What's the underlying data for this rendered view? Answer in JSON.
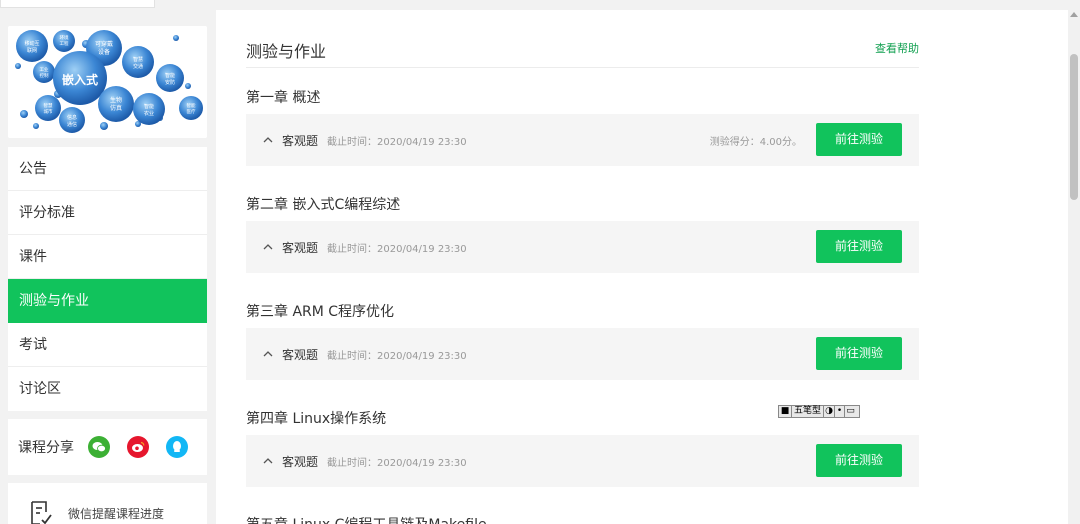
{
  "logo": {
    "center": "嵌入式",
    "bubbles": [
      "移动互联网",
      "环境工程",
      "可穿戴设备",
      "智慧交通",
      "工业控制",
      "智能安防",
      "生物仿真",
      "智慧城市",
      "信息通信",
      "智能农业",
      "智能医疗"
    ]
  },
  "sidebar": {
    "items": [
      {
        "label": "公告"
      },
      {
        "label": "评分标准"
      },
      {
        "label": "课件"
      },
      {
        "label": "测验与作业"
      },
      {
        "label": "考试"
      },
      {
        "label": "讨论区"
      }
    ],
    "share_label": "课程分享",
    "share_icons": [
      "wechat-icon",
      "weibo-icon",
      "qq-icon"
    ],
    "reminder_label": "微信提醒课程进度"
  },
  "main": {
    "title": "测验与作业",
    "help": "查看帮助",
    "chapters": [
      {
        "title": "第一章 概述",
        "type": "客观题",
        "deadline": "截止时间：2020/04/19 23:30",
        "score": "测验得分：4.00分。",
        "button": "前往测验"
      },
      {
        "title": "第二章 嵌入式C编程综述",
        "type": "客观题",
        "deadline": "截止时间：2020/04/19 23:30",
        "score": "",
        "button": "前往测验"
      },
      {
        "title": "第三章 ARM C程序优化",
        "type": "客观题",
        "deadline": "截止时间：2020/04/19 23:30",
        "score": "",
        "button": "前往测验"
      },
      {
        "title": "第四章 Linux操作系统",
        "type": "客观题",
        "deadline": "截止时间：2020/04/19 23:30",
        "score": "",
        "button": "前往测验"
      },
      {
        "title": "第五章 Linux C编程工具链及Makefile"
      }
    ]
  },
  "ime": {
    "mode": "五笔型"
  },
  "colors": {
    "accent": "#11c35c",
    "wechat": "#3cb034",
    "weibo": "#e6162d",
    "qq": "#12b7f5"
  }
}
